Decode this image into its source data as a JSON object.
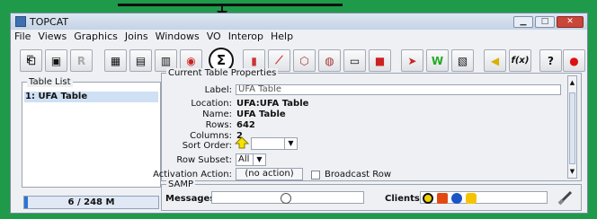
{
  "app": {
    "title": "TOPCAT"
  },
  "menu": [
    "File",
    "Views",
    "Graphics",
    "Joins",
    "Windows",
    "VO",
    "Interop",
    "Help"
  ],
  "toolbar": {
    "buttons": [
      {
        "name": "load-table-icon",
        "glyph": "⎗"
      },
      {
        "name": "save-table-icon",
        "glyph": "💾"
      },
      {
        "name": "broadcast-icon",
        "glyph": "R"
      },
      {
        "name": "columns-icon",
        "glyph": "▦"
      },
      {
        "name": "subsets-icon",
        "glyph": "▤"
      },
      {
        "name": "parameters-icon",
        "glyph": "▥"
      },
      {
        "name": "activation-icon",
        "glyph": "◉"
      },
      {
        "name": "statistics-icon",
        "glyph": "Σ"
      },
      {
        "name": "histogram-icon",
        "glyph": "▮"
      },
      {
        "name": "plane-plot-icon",
        "glyph": "⟋"
      },
      {
        "name": "cube-plot-icon",
        "glyph": "⬡"
      },
      {
        "name": "sphere-plot-icon",
        "glyph": "◍"
      },
      {
        "name": "table-plot-icon",
        "glyph": "▭"
      },
      {
        "name": "density-plot-icon",
        "glyph": "■"
      },
      {
        "name": "pair-match-icon",
        "glyph": "➤"
      },
      {
        "name": "concatenate-icon",
        "glyph": "W"
      },
      {
        "name": "multi-window-icon",
        "glyph": "▧"
      },
      {
        "name": "activation-action-icon",
        "glyph": "◀"
      },
      {
        "name": "function-icon",
        "glyph": "f(x)"
      },
      {
        "name": "help-icon",
        "glyph": "?"
      },
      {
        "name": "exit-icon",
        "glyph": "●"
      }
    ]
  },
  "table_list": {
    "title": "Table List",
    "items": [
      "1: UFA Table"
    ]
  },
  "memory": {
    "text": "6 / 248 M",
    "fraction": 0.024
  },
  "properties": {
    "title": "Current Table Properties",
    "label_label": "Label:",
    "label_value": "UFA Table",
    "location_label": "Location:",
    "location_value": "UFA:UFA Table",
    "name_label": "Name:",
    "name_value": "UFA Table",
    "rows_label": "Rows:",
    "rows_value": "642",
    "columns_label": "Columns:",
    "columns_value": "2",
    "sort_label": "Sort Order:",
    "subset_label": "Row Subset:",
    "subset_value": "All",
    "activation_label": "Activation Action:",
    "activation_value": "(no action)",
    "broadcast_label": "Broadcast Row"
  },
  "samp": {
    "title": "SAMP",
    "messages_label": "Messages:",
    "clients_label": "Clients:"
  },
  "colors": {
    "background": "#1f9a4a",
    "selection": "#cfe0f5",
    "memory_bar": "#2f73d1"
  }
}
